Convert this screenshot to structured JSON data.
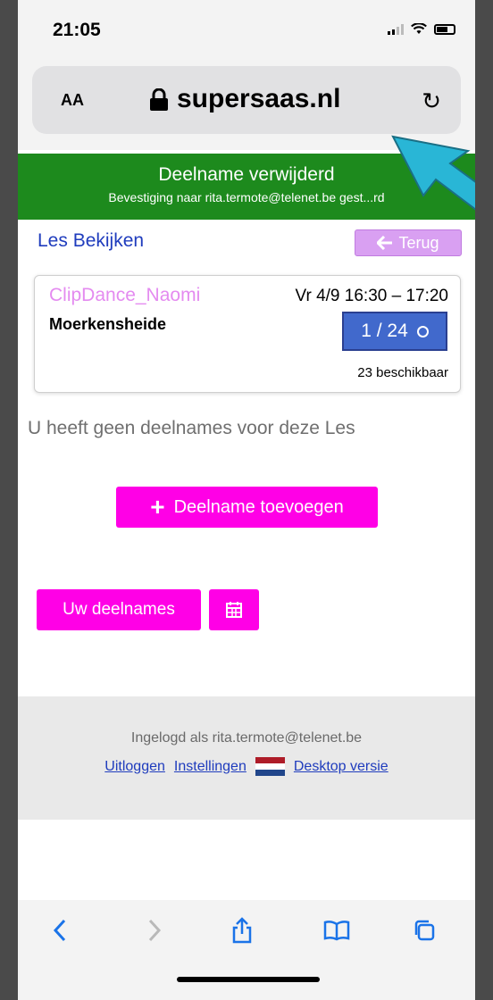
{
  "status": {
    "time": "21:05"
  },
  "browser": {
    "aa_label": "AA",
    "domain": "supersaas.nl",
    "reload_symbol": "↻"
  },
  "banner": {
    "title": "Deelname verwijderd",
    "subtitle": "Bevestiging naar rita.termote@telenet.be gest...rd"
  },
  "page": {
    "title": "Les Bekijken",
    "back_label": "Terug",
    "back_icon": "arrow-left-icon"
  },
  "class_card": {
    "name": "ClipDance_Naomi",
    "date": "Vr 4/9  16:30 – 17:20",
    "location": "Moerkensheide",
    "capacity": "1 / 24",
    "available": "23 beschikbaar"
  },
  "no_bookings": "U heeft geen deelnames voor deze Les",
  "buttons": {
    "add_label": "Deelname toevoegen",
    "my_bookings_label": "Uw deelnames",
    "calendar_icon": "calendar-icon"
  },
  "footer": {
    "logged_in_as": "Ingelogd als rita.termote@telenet.be",
    "logout": "Uitloggen",
    "settings": "Instellingen",
    "desktop": "Desktop versie"
  },
  "colors": {
    "banner_green": "#1d8a1d",
    "accent_magenta": "#ff00e6",
    "link_blue": "#1f3cbd",
    "capacity_blue": "#4169cc",
    "annotation_arrow": "#29b6d6"
  }
}
